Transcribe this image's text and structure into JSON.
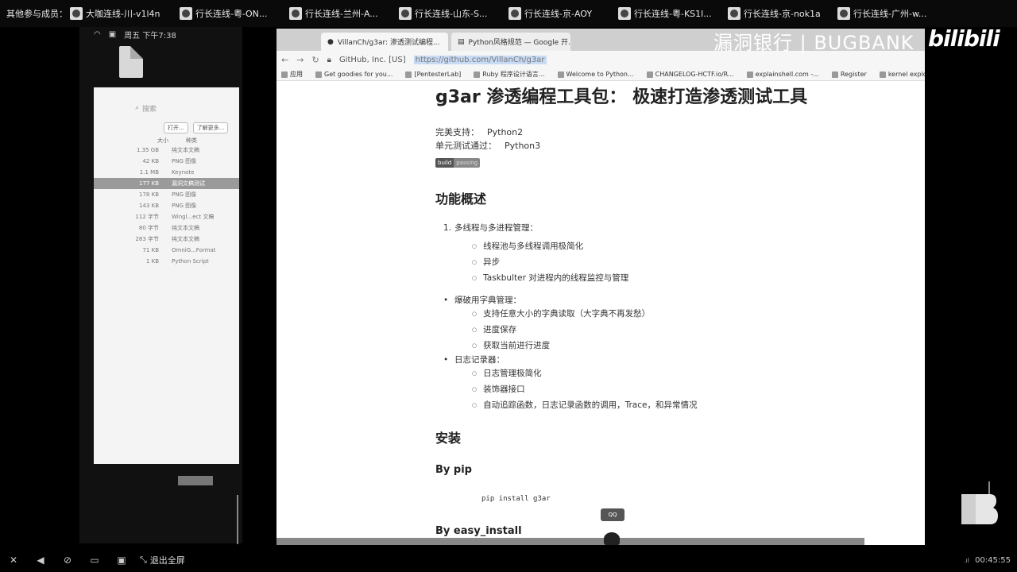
{
  "topbar": {
    "label": "其他参与成员：",
    "participants": [
      {
        "name": "大咖连线-川-v1l4n"
      },
      {
        "name": "行长连线-粤-ON..."
      },
      {
        "name": "行长连线-兰州-A..."
      },
      {
        "name": "行长连线-山东-S..."
      },
      {
        "name": "行长连线-京-AOY"
      },
      {
        "name": "行长连线-粤-KS1l..."
      },
      {
        "name": "行长连线-京-nok1a"
      },
      {
        "name": "行长连线-广州-w..."
      }
    ]
  },
  "desktop": {
    "status_time": "周五 下午7:38"
  },
  "finder": {
    "search_placeholder": "搜索",
    "btn_open": "打开...",
    "btn_more": "了解更多...",
    "col_size": "大小",
    "col_kind": "种类",
    "rows": [
      {
        "size": "1.35 GB",
        "kind": "纯文本文稿",
        "selected": false
      },
      {
        "size": "42 KB",
        "kind": "PNG 图像",
        "selected": false
      },
      {
        "size": "1.1 MB",
        "kind": "Keynote",
        "selected": false
      },
      {
        "size": "177 KB",
        "kind": "漏洞文稿测试",
        "selected": true
      },
      {
        "size": "178 KB",
        "kind": "PNG 图像",
        "selected": false
      },
      {
        "size": "143 KB",
        "kind": "PNG 图像",
        "selected": false
      },
      {
        "size": "112 字节",
        "kind": "Wingl...ect 文稿",
        "selected": false
      },
      {
        "size": "80 字节",
        "kind": "纯文本文稿",
        "selected": false
      },
      {
        "size": "283 字节",
        "kind": "纯文本文稿",
        "selected": false
      },
      {
        "size": "71 KB",
        "kind": "OmniG...Format",
        "selected": false
      },
      {
        "size": "1 KB",
        "kind": "Python Script",
        "selected": false
      }
    ]
  },
  "browser": {
    "tabs": [
      {
        "title": "VillanCh/g3ar: 渗透测试编程...",
        "active": true
      },
      {
        "title": "Python风格规范 — Google 开...",
        "active": false
      }
    ],
    "address": {
      "site": "GitHub, Inc. [US]",
      "url_host": "https://github.com",
      "url_path": "/VillanCh/g3ar"
    },
    "bookmarks": [
      "应用",
      "Get goodies for you...",
      "[PentesterLab]",
      "Ruby 程序设计语言...",
      "Welcome to Python...",
      "CHANGELOG-HCTF.io/R...",
      "explainshell.com -...",
      "Register",
      "kernel explo"
    ]
  },
  "readme": {
    "title": "g3ar 渗透编程工具包： 极速打造渗透测试工具",
    "support_label": "完美支持：",
    "support_value": "Python2",
    "unittest_label": "单元测试通过：",
    "unittest_value": "Python3",
    "badge_left": "build",
    "badge_right": "passing",
    "features_heading": "功能概述",
    "section1": {
      "num": "1.",
      "title": "多线程与多进程管理：",
      "items": [
        "线程池与多线程调用极简化",
        "异步",
        "Taskbulter 对进程内的线程监控与管理"
      ]
    },
    "section2": {
      "title": "爆破用字典管理：",
      "items": [
        "支持任意大小的字典读取（大字典不再发愁）",
        "进度保存",
        "获取当前进行进度"
      ]
    },
    "section3": {
      "title": "日志记录器：",
      "items": [
        "日志管理极简化",
        "装饰器接口",
        "自动追踪函数，日志记录函数的调用，Trace，和异常情况"
      ]
    },
    "install_heading": "安装",
    "by_pip": "By pip",
    "pip_cmd": "pip install g3ar",
    "by_easy": "By easy_install"
  },
  "overlay": {
    "watermark": "漏洞银行 | BUGBANK",
    "platform_logo": "bilibili",
    "qq_tip": "QQ"
  },
  "player": {
    "fullscreen_label": "退出全屏",
    "time": "00:45:55",
    "signal": ".ıl"
  }
}
